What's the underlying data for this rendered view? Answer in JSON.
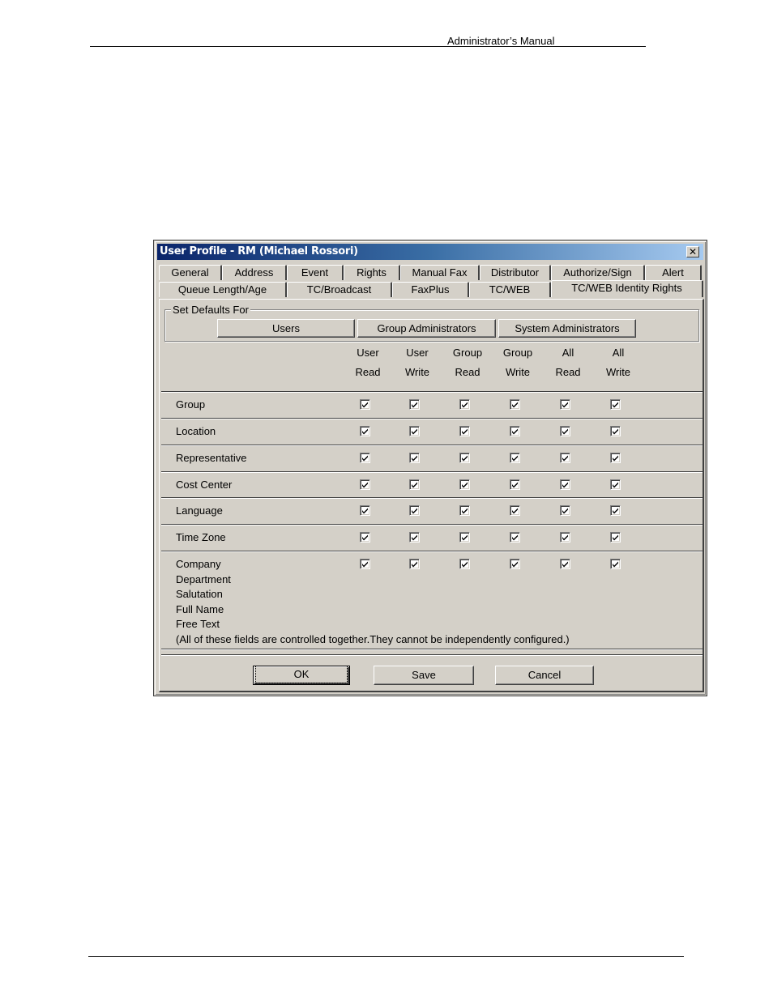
{
  "document": {
    "header_text": "Administrator’s Manual"
  },
  "dialog": {
    "title": "User Profile - RM (Michael Rossori)",
    "close_label": "✕",
    "tabs_row1": [
      {
        "label": "General"
      },
      {
        "label": "Address"
      },
      {
        "label": "Event"
      },
      {
        "label": "Rights"
      },
      {
        "label": "Manual Fax"
      },
      {
        "label": "Distributor"
      },
      {
        "label": "Authorize/Sign"
      },
      {
        "label": "Alert"
      }
    ],
    "tabs_row2": [
      {
        "label": "Queue Length/Age"
      },
      {
        "label": "TC/Broadcast"
      },
      {
        "label": "FaxPlus"
      },
      {
        "label": "TC/WEB"
      },
      {
        "label": "TC/WEB Identity Rights",
        "active": true
      }
    ],
    "set_defaults": {
      "label": "Set Defaults For",
      "buttons": [
        "Users",
        "Group Administrators",
        "System Administrators"
      ]
    },
    "columns": [
      {
        "line1": "User",
        "line2": "Read"
      },
      {
        "line1": "User",
        "line2": "Write"
      },
      {
        "line1": "Group",
        "line2": "Read"
      },
      {
        "line1": "Group",
        "line2": "Write"
      },
      {
        "line1": "All",
        "line2": "Read"
      },
      {
        "line1": "All",
        "line2": "Write"
      }
    ],
    "rows": [
      {
        "labels": [
          "Group"
        ],
        "checked": [
          true,
          true,
          true,
          true,
          true,
          true
        ]
      },
      {
        "labels": [
          "Location"
        ],
        "checked": [
          true,
          true,
          true,
          true,
          true,
          true
        ]
      },
      {
        "labels": [
          "Representative"
        ],
        "checked": [
          true,
          true,
          true,
          true,
          true,
          true
        ]
      },
      {
        "labels": [
          "Cost Center"
        ],
        "checked": [
          true,
          true,
          true,
          true,
          true,
          true
        ]
      },
      {
        "labels": [
          "Language"
        ],
        "checked": [
          true,
          true,
          true,
          true,
          true,
          true
        ]
      },
      {
        "labels": [
          "Time Zone"
        ],
        "checked": [
          true,
          true,
          true,
          true,
          true,
          true
        ]
      },
      {
        "labels": [
          "Company",
          "Department",
          "Salutation",
          "Full Name",
          "Free Text"
        ],
        "checked": [
          true,
          true,
          true,
          true,
          true,
          true
        ]
      }
    ],
    "note": "(All of these fields are controlled together.They cannot be independently configured.)",
    "footer_buttons": {
      "ok": "OK",
      "save": "Save",
      "cancel": "Cancel"
    }
  }
}
